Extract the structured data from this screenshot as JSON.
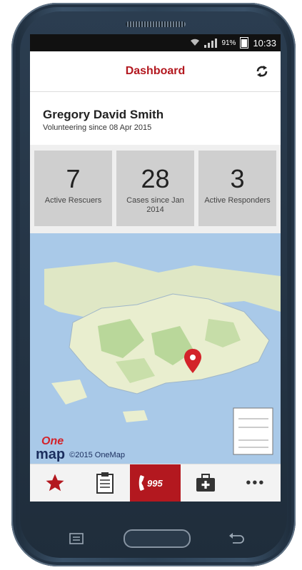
{
  "status_bar": {
    "battery": "91%",
    "time": "10:33"
  },
  "header": {
    "title": "Dashboard"
  },
  "profile": {
    "name": "Gregory David Smith",
    "since": "Volunteering since 08 Apr 2015"
  },
  "stats": [
    {
      "value": "7",
      "label": "Active Rescuers"
    },
    {
      "value": "28",
      "label": "Cases since Jan 2014"
    },
    {
      "value": "3",
      "label": "Active Responders"
    }
  ],
  "map": {
    "logo_top": "One",
    "logo_bottom": "map",
    "copyright": "©2015 OneMap"
  },
  "tabs": [
    {
      "icon": "star-icon"
    },
    {
      "icon": "clipboard-icon"
    },
    {
      "icon": "phone-995-icon",
      "label": "995",
      "active": true
    },
    {
      "icon": "first-aid-kit-icon"
    },
    {
      "icon": "more-icon",
      "label": "•••"
    }
  ],
  "colors": {
    "accent": "#b3181f",
    "map_water": "#a9c9e8",
    "map_land": "#e9eecf",
    "map_green": "#b9d79a"
  }
}
